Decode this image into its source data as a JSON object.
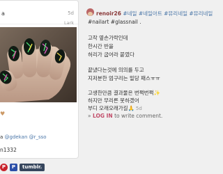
{
  "post": {
    "user_fragment": "a",
    "time": "5d",
    "filter": "Lark",
    "tags_line": {
      "prefix": "a",
      "mention1": "@gdekan",
      "mention2": "@r_sso"
    },
    "id_line": "n1332"
  },
  "share": {
    "pin_label": "P",
    "p_label": "P",
    "tumblr_label": "tumblr."
  },
  "caption": {
    "username": "renoir26",
    "hashtags_line1": "#네일 #네일아트 #뮤리네일 #뮤리네일",
    "hashtags_line2": "#nailart #glassnail .",
    "lines": [
      "고작 옆손가락인데",
      "한시간 반을",
      "허리가 굽어라 붙였다",
      "끝냈다는것에 의의를 두고",
      "지저분한 엄구리는 밑당 패스ㅠㅠ",
      "고생한만큼 결과물은 번쩍번쩍✨",
      "하지만 무리른 못하겠어",
      "부디 오래오래가길🙏"
    ],
    "last_time": "5d",
    "login_link": "LOG IN",
    "login_rest": "to write comment.",
    "login_arrow": "»"
  }
}
